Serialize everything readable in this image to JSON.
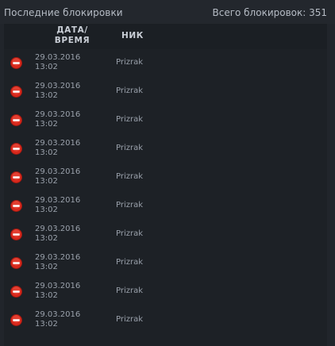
{
  "header": {
    "title": "Последние блокировки",
    "total": "Всего блокировок: 351"
  },
  "table": {
    "columns": {
      "date_line1": "ДАТА/",
      "date_line2": "ВРЕМЯ",
      "nick": "НИК"
    },
    "rows": [
      {
        "date": "29.03.2016",
        "time": "13:02",
        "nick": "Prizrak"
      },
      {
        "date": "29.03.2016",
        "time": "13:02",
        "nick": "Prizrak"
      },
      {
        "date": "29.03.2016",
        "time": "13:02",
        "nick": "Prizrak"
      },
      {
        "date": "29.03.2016",
        "time": "13:02",
        "nick": "Prizrak"
      },
      {
        "date": "29.03.2016",
        "time": "13:02",
        "nick": "Prizrak"
      },
      {
        "date": "29.03.2016",
        "time": "13:02",
        "nick": "Prizrak"
      },
      {
        "date": "29.03.2016",
        "time": "13:02",
        "nick": "Prizrak"
      },
      {
        "date": "29.03.2016",
        "time": "13:02",
        "nick": "Prizrak"
      },
      {
        "date": "29.03.2016",
        "time": "13:02",
        "nick": "Prizrak"
      },
      {
        "date": "29.03.2016",
        "time": "13:02",
        "nick": "Prizrak"
      }
    ],
    "row_icon": "block-icon"
  },
  "colors": {
    "background": "#21252b",
    "table_background": "#1d2126",
    "icon_red": "#d8281c"
  }
}
